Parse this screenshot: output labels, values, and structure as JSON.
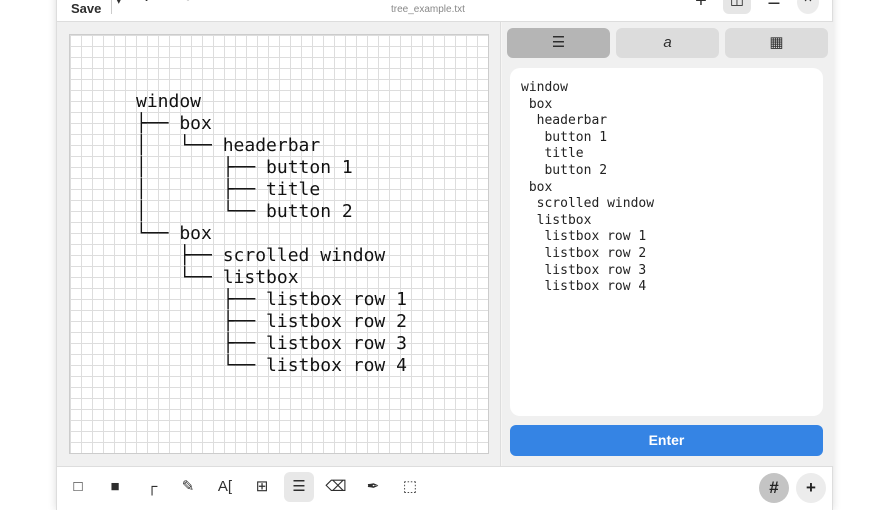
{
  "header": {
    "save_label": "Save",
    "dropdown_icon": "▾",
    "undo_icon": "↶",
    "redo_icon": "↷",
    "filename": "tree_example.txt",
    "add_icon": "+",
    "view_icon": "◫",
    "menu_icon": "☰",
    "close_icon": "×"
  },
  "tree_text": "window\n├── box\n│   └── headerbar\n│       ├── button 1\n│       ├── title\n│       └── button 2\n└── box\n    ├── scrolled window\n    └── listbox\n        ├── listbox row 1\n        ├── listbox row 2\n        ├── listbox row 3\n        └── listbox row 4",
  "tabs": [
    {
      "icon": "☰"
    },
    {
      "icon": "a"
    },
    {
      "icon": "▦"
    }
  ],
  "input_text": "window\n box\n  headerbar\n   button 1\n   title\n   button 2\n box\n  scrolled window\n  listbox\n   listbox row 1\n   listbox row 2\n   listbox row 3\n   listbox row 4",
  "enter_label": "Enter",
  "tools": [
    {
      "icon": "□"
    },
    {
      "icon": "■"
    },
    {
      "icon": "┌"
    },
    {
      "icon": "✎"
    },
    {
      "icon": "A["
    },
    {
      "icon": "⊞"
    },
    {
      "icon": "☰"
    },
    {
      "icon": "⌫"
    },
    {
      "icon": "✒"
    },
    {
      "icon": "⬚"
    }
  ],
  "grid_label": "#",
  "add_label": "+"
}
